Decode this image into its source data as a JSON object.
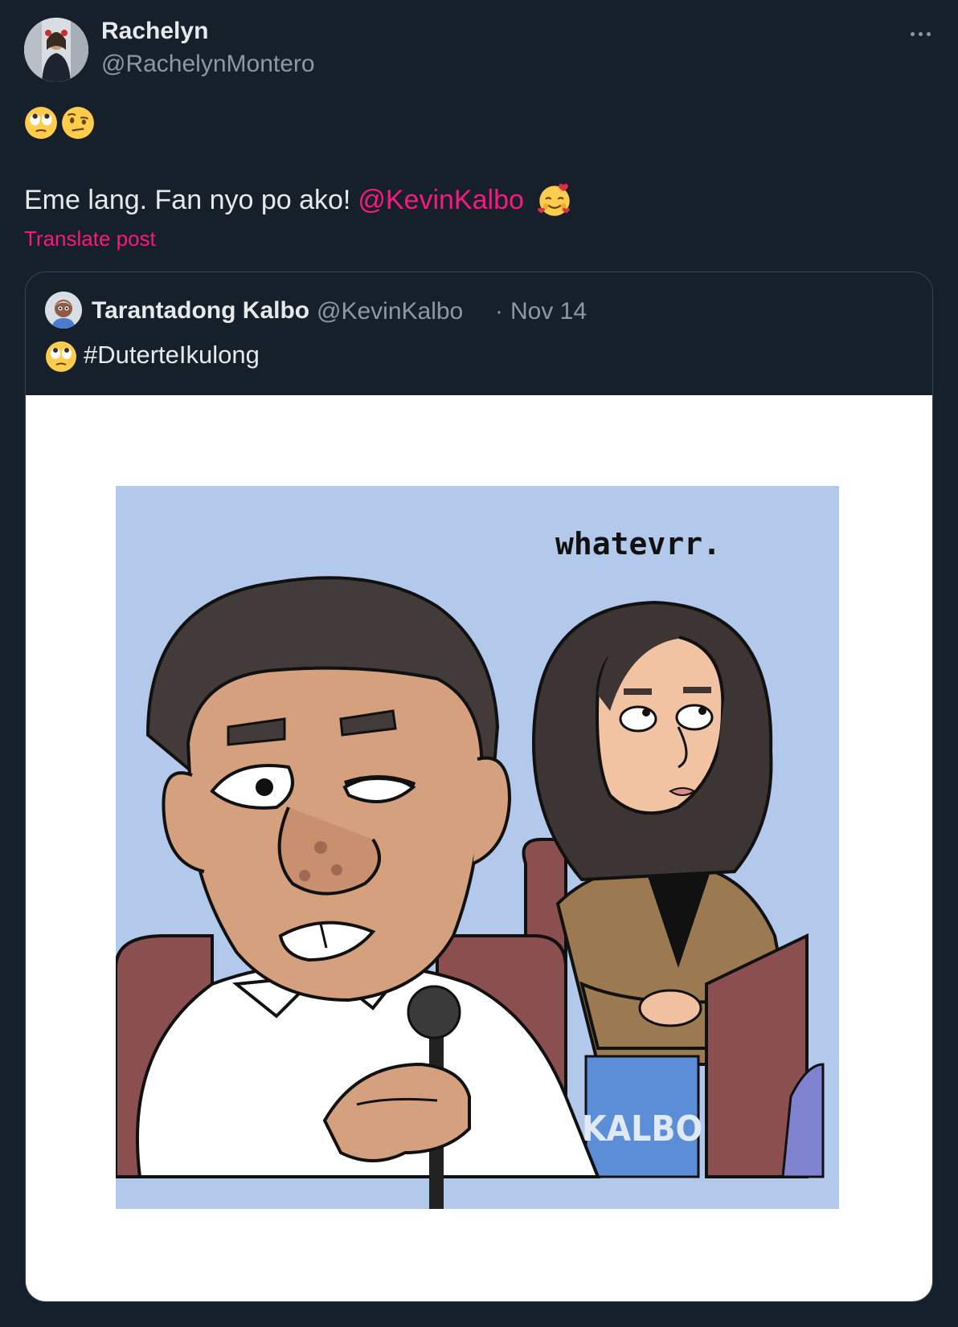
{
  "post": {
    "author": {
      "name": "Rachelyn",
      "handle": "@RachelynMontero"
    },
    "emoji_line": [
      "face-with-rolling-eyes",
      "face-with-raised-eyebrow"
    ],
    "text": "Eme lang. Fan nyo po ako!",
    "mention": "@KevinKalbo",
    "text_emoji": "smiling-face-with-hearts",
    "translate_label": "Translate post"
  },
  "quote": {
    "author_name": "Tarantadong Kalbo",
    "author_handle": "@KevinKalbo",
    "separator": "·",
    "date": "Nov 14",
    "emoji": "face-with-rolling-eyes",
    "hashtag": "#DuterteIkulong",
    "comic": {
      "speech_text": "whatevrr.",
      "signature": "KALBO"
    }
  },
  "colors": {
    "background": "#15202b",
    "accent": "#f91880",
    "secondary_text": "#8b98a5",
    "border": "#38444d"
  }
}
